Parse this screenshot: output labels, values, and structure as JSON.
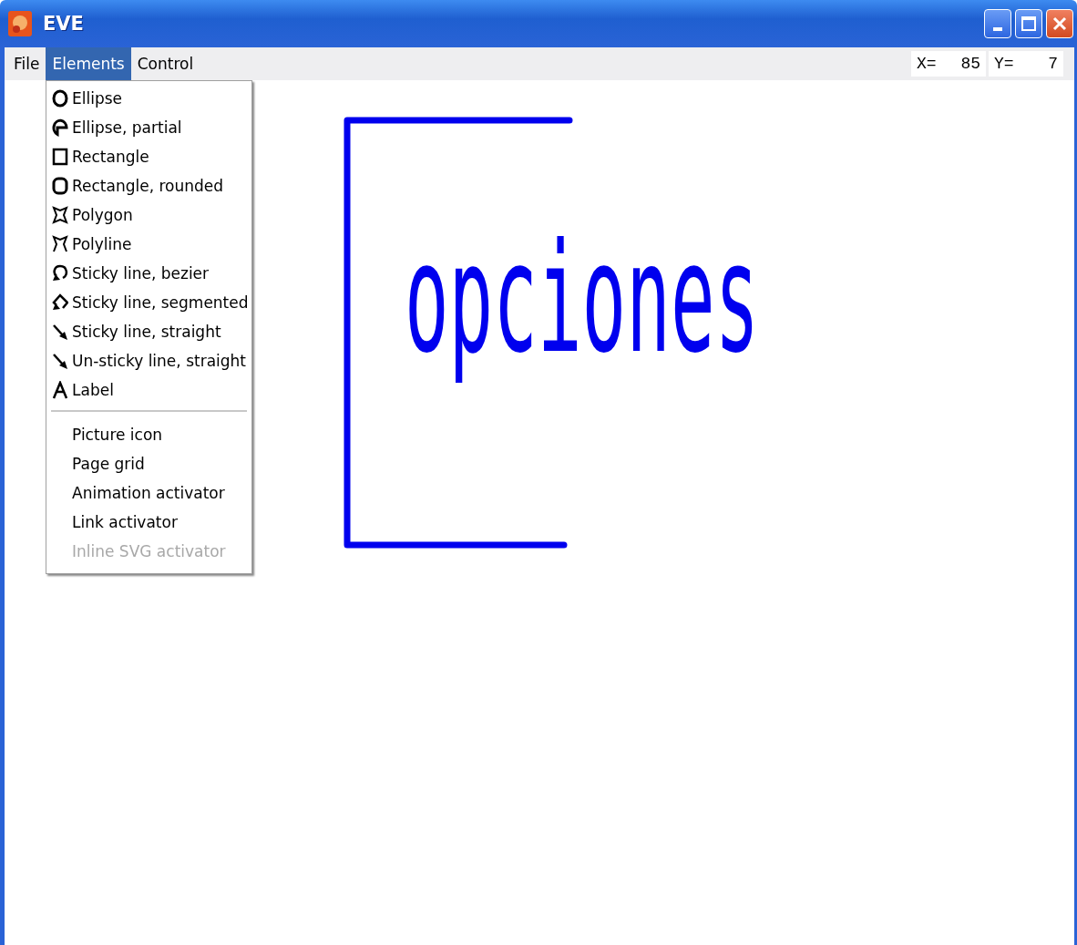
{
  "window": {
    "title": "EVE"
  },
  "menu_bar": [
    {
      "label": "File",
      "selected": false
    },
    {
      "label": "Elements",
      "selected": true
    },
    {
      "label": "Control",
      "selected": false
    }
  ],
  "coordinates": {
    "x_label": "X=",
    "x_value": "85",
    "y_label": "Y=",
    "y_value": "7"
  },
  "dropdown": {
    "groups": [
      [
        {
          "label": "Ellipse",
          "kind": "ellipse",
          "disabled": false
        },
        {
          "label": "Ellipse, partial",
          "kind": "arc",
          "disabled": false
        },
        {
          "label": "Rectangle",
          "kind": "rectangle",
          "disabled": false
        },
        {
          "label": "Rectangle, rounded",
          "kind": "rounded",
          "disabled": false
        },
        {
          "label": "Polygon",
          "kind": "polygon",
          "disabled": false
        },
        {
          "label": "Polyline",
          "kind": "polyline",
          "disabled": false
        },
        {
          "label": "Sticky line, bezier",
          "kind": "bezier",
          "disabled": false
        },
        {
          "label": "Sticky line, segmented",
          "kind": "segmented",
          "disabled": false
        },
        {
          "label": "Sticky line, straight",
          "kind": "arrow",
          "disabled": false
        },
        {
          "label": "Un-sticky line, straight",
          "kind": "arrow",
          "disabled": false
        },
        {
          "label": "Label",
          "kind": "label",
          "disabled": false
        }
      ],
      [
        {
          "label": "Picture icon",
          "kind": "plain",
          "disabled": false
        },
        {
          "label": "Page grid",
          "kind": "plain",
          "disabled": false
        },
        {
          "label": "Animation activator",
          "kind": "plain",
          "disabled": false
        },
        {
          "label": "Link activator",
          "kind": "plain",
          "disabled": false
        },
        {
          "label": "Inline SVG activator",
          "kind": "plain",
          "disabled": true
        }
      ]
    ]
  },
  "canvas": {
    "text": "opciones"
  }
}
